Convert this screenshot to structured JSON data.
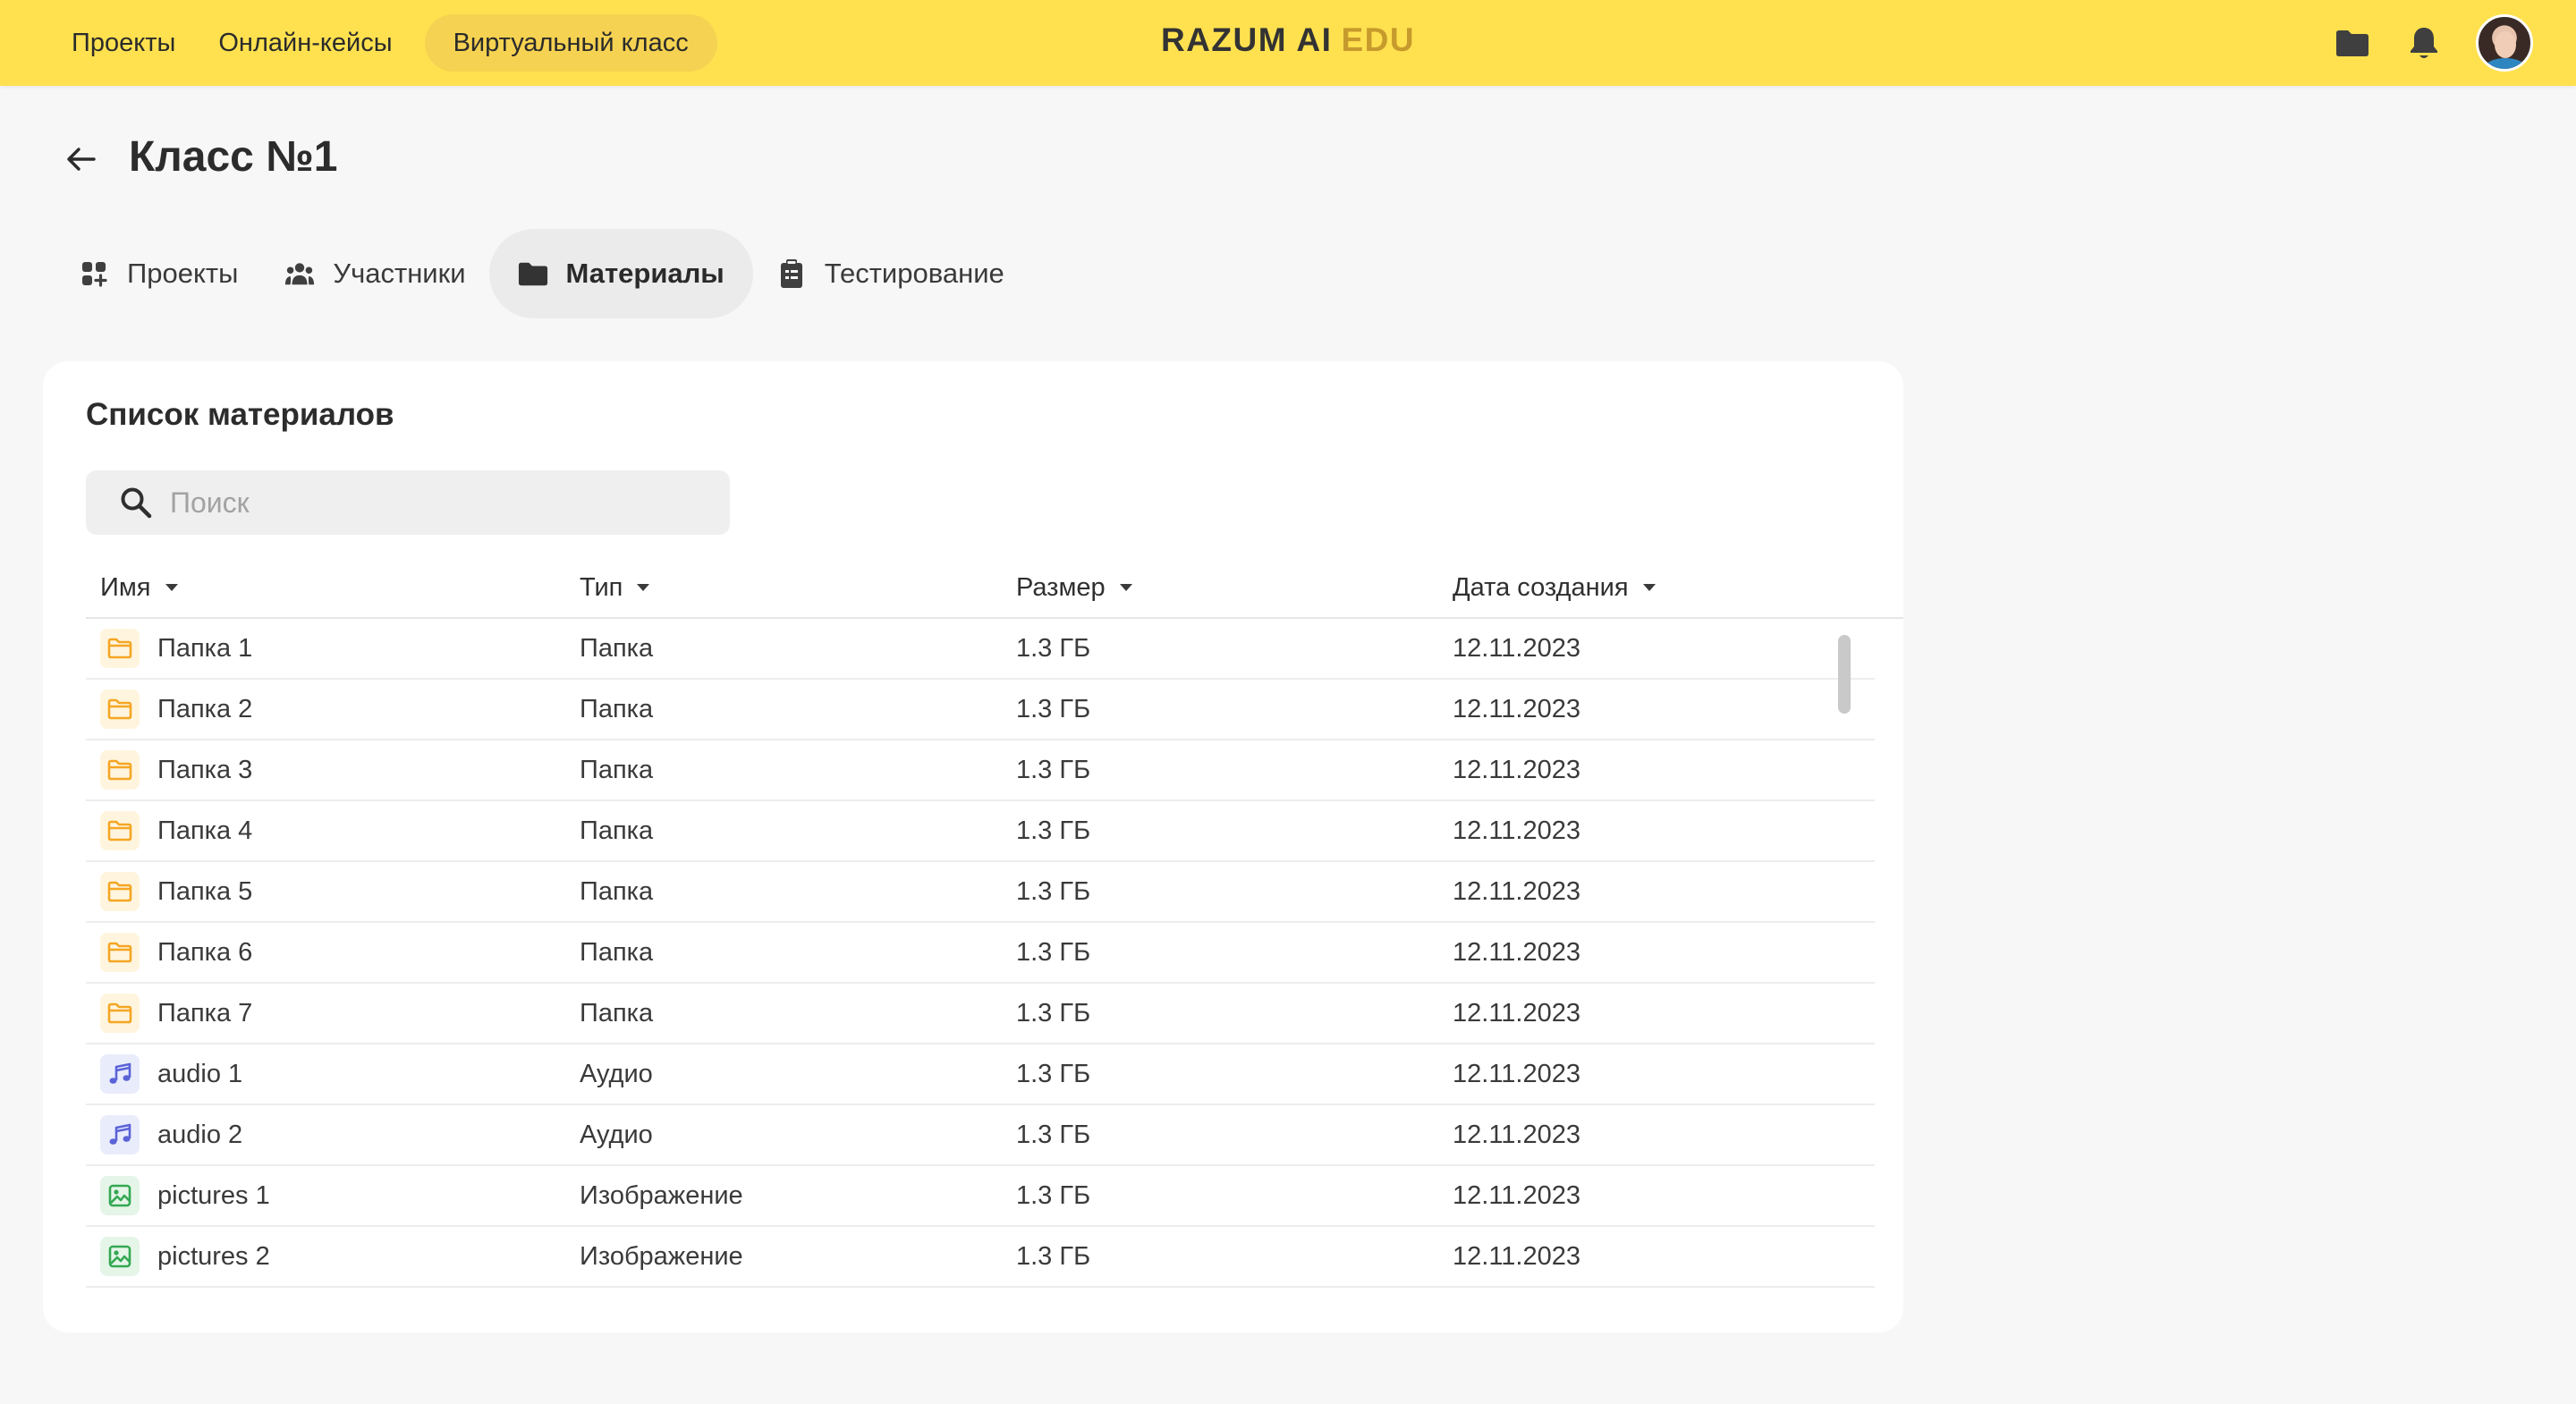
{
  "topnav": {
    "items": [
      {
        "label": "Проекты"
      },
      {
        "label": "Онлайн-кейсы"
      },
      {
        "label": "Виртуальный класс",
        "active": true
      }
    ]
  },
  "brand": {
    "main": "RAZUM AI",
    "accent": "EDU"
  },
  "header_icons": [
    "folder-icon",
    "bell-icon",
    "user-avatar"
  ],
  "page": {
    "title": "Класс №1"
  },
  "tabs": [
    {
      "label": "Проекты",
      "icon": "apps-add-icon"
    },
    {
      "label": "Участники",
      "icon": "people-icon"
    },
    {
      "label": "Материалы",
      "icon": "folder-icon",
      "active": true
    },
    {
      "label": "Тестирование",
      "icon": "clipboard-icon"
    }
  ],
  "materials": {
    "title": "Список материалов",
    "search_placeholder": "Поиск",
    "columns": {
      "name": "Имя",
      "type": "Тип",
      "size": "Размер",
      "date": "Дата создания"
    },
    "rows": [
      {
        "name": "Папка 1",
        "type": "Папка",
        "size": "1.3 ГБ",
        "date": "12.11.2023",
        "icon": "folder"
      },
      {
        "name": "Папка 2",
        "type": "Папка",
        "size": "1.3 ГБ",
        "date": "12.11.2023",
        "icon": "folder"
      },
      {
        "name": "Папка 3",
        "type": "Папка",
        "size": "1.3 ГБ",
        "date": "12.11.2023",
        "icon": "folder"
      },
      {
        "name": "Папка 4",
        "type": "Папка",
        "size": "1.3 ГБ",
        "date": "12.11.2023",
        "icon": "folder"
      },
      {
        "name": "Папка 5",
        "type": "Папка",
        "size": "1.3 ГБ",
        "date": "12.11.2023",
        "icon": "folder"
      },
      {
        "name": "Папка 6",
        "type": "Папка",
        "size": "1.3 ГБ",
        "date": "12.11.2023",
        "icon": "folder"
      },
      {
        "name": "Папка 7",
        "type": "Папка",
        "size": "1.3 ГБ",
        "date": "12.11.2023",
        "icon": "folder"
      },
      {
        "name": "audio 1",
        "type": "Аудио",
        "size": "1.3 ГБ",
        "date": "12.11.2023",
        "icon": "audio"
      },
      {
        "name": "audio 2",
        "type": "Аудио",
        "size": "1.3 ГБ",
        "date": "12.11.2023",
        "icon": "audio"
      },
      {
        "name": "pictures 1",
        "type": "Изображение",
        "size": "1.3 ГБ",
        "date": "12.11.2023",
        "icon": "image"
      },
      {
        "name": "pictures 2",
        "type": "Изображение",
        "size": "1.3 ГБ",
        "date": "12.11.2023",
        "icon": "image"
      }
    ]
  },
  "colors": {
    "topbar": "#ffe14f",
    "active_nav": "#f5d251",
    "folder": "#f5a623",
    "audio": "#5b63d8",
    "image": "#34a853"
  }
}
